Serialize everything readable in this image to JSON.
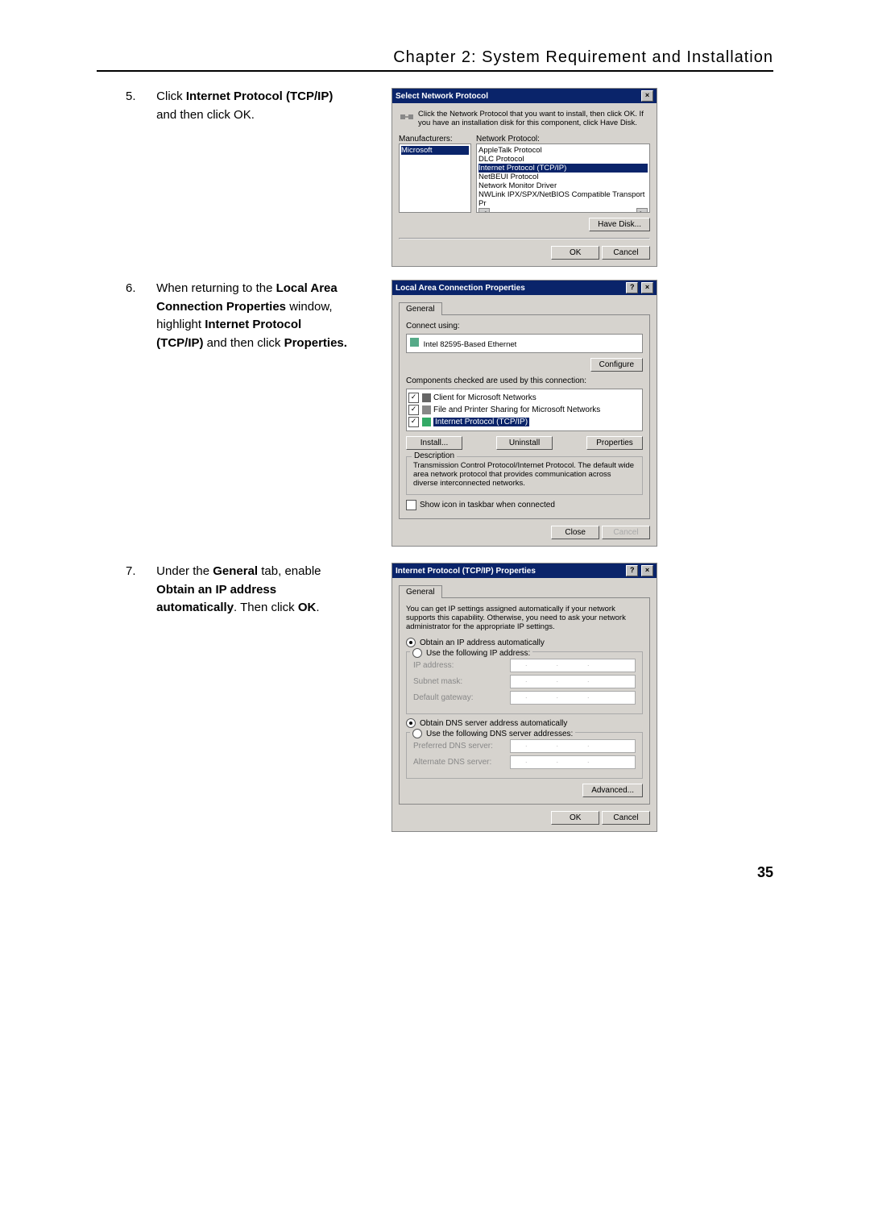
{
  "chapter_header": "Chapter 2: System Requirement and Installation",
  "step5": {
    "num": "5.",
    "text_pre": "Click ",
    "bold1": "Internet Protocol (TCP/IP)",
    "text_post": " and then click OK."
  },
  "step6": {
    "num": "6.",
    "text1": "When returning to the ",
    "bold1": "Local Area Connection Properties",
    "text2": " window, highlight ",
    "bold2": "Internet Protocol (TCP/IP)",
    "text3": " and then click ",
    "bold3": "Properties."
  },
  "step7": {
    "num": "7.",
    "text1": "Under the ",
    "bold1": "General",
    "text2": " tab, enable ",
    "bold2": "Obtain an IP address automatically",
    "text3": ". Then click ",
    "bold3": "OK",
    "text4": "."
  },
  "dlg1": {
    "title": "Select Network Protocol",
    "desc": "Click the Network Protocol that you want to install, then click OK. If you have an installation disk for this component, click Have Disk.",
    "manu_label": "Manufacturers:",
    "proto_label": "Network Protocol:",
    "manu_item": "Microsoft",
    "protos": [
      "AppleTalk Protocol",
      "DLC Protocol",
      "Internet Protocol (TCP/IP)",
      "NetBEUI Protocol",
      "Network Monitor Driver",
      "NWLink IPX/SPX/NetBIOS Compatible Transport Pr"
    ],
    "have_disk": "Have Disk...",
    "ok": "OK",
    "cancel": "Cancel"
  },
  "dlg2": {
    "title": "Local Area Connection Properties",
    "tab": "General",
    "connect_using": "Connect using:",
    "adapter": "Intel 82595-Based Ethernet",
    "configure": "Configure",
    "comp_label": "Components checked are used by this connection:",
    "comps": [
      "Client for Microsoft Networks",
      "File and Printer Sharing for Microsoft Networks",
      "Internet Protocol (TCP/IP)"
    ],
    "install": "Install...",
    "uninstall": "Uninstall",
    "properties": "Properties",
    "desc_label": "Description",
    "desc": "Transmission Control Protocol/Internet Protocol. The default wide area network protocol that provides communication across diverse interconnected networks.",
    "show_icon": "Show icon in taskbar when connected",
    "close": "Close",
    "cancel": "Cancel"
  },
  "dlg3": {
    "title": "Internet Protocol (TCP/IP) Properties",
    "tab": "General",
    "desc": "You can get IP settings assigned automatically if your network supports this capability. Otherwise, you need to ask your network administrator for the appropriate IP settings.",
    "r1": "Obtain an IP address automatically",
    "r2": "Use the following IP address:",
    "ip_label": "IP address:",
    "subnet_label": "Subnet mask:",
    "gateway_label": "Default gateway:",
    "r3": "Obtain DNS server address automatically",
    "r4": "Use the following DNS server addresses:",
    "pref_dns": "Preferred DNS server:",
    "alt_dns": "Alternate DNS server:",
    "advanced": "Advanced...",
    "ok": "OK",
    "cancel": "Cancel"
  },
  "page_number": "35"
}
